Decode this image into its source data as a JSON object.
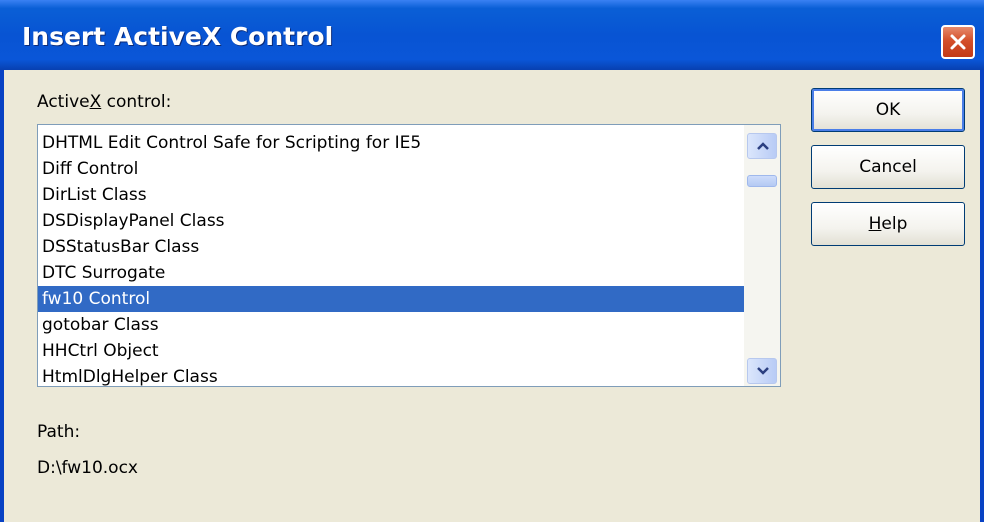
{
  "window": {
    "title": "Insert ActiveX Control"
  },
  "activex": {
    "label_prefix": "Active",
    "label_mnemonic": "X",
    "label_suffix": " control:",
    "items": [
      "DHTML Edit Control Safe for Scripting for IE5",
      "Diff Control",
      "DirList Class",
      "DSDisplayPanel Class",
      "DSStatusBar Class",
      "DTC Surrogate",
      "fw10 Control",
      "gotobar Class",
      "HHCtrl Object",
      "HtmlDlgHelper Class"
    ],
    "selected": "fw10 Control"
  },
  "buttons": {
    "ok": "OK",
    "cancel": "Cancel",
    "help_mnemonic": "H",
    "help_rest": "elp"
  },
  "path": {
    "label": "Path:",
    "value": "D:\\fw10.ocx"
  },
  "colors": {
    "titlebar": "#0854d3",
    "selection": "#316ac5",
    "dialog_bg": "#ece9d8",
    "close_button": "#c23a17"
  }
}
